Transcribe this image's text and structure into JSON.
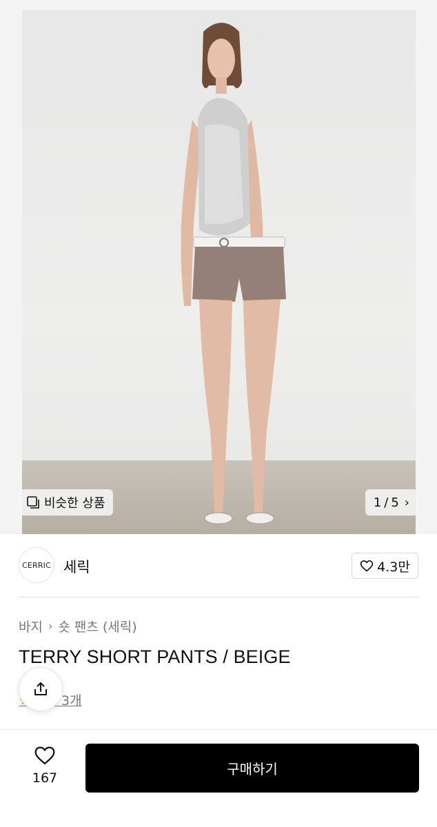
{
  "hero": {
    "similar_label": "비슷한 상품",
    "pager": {
      "current": "1",
      "separator": "/",
      "total": "5"
    }
  },
  "brand": {
    "logo_text": "CERRIC",
    "name": "세릭",
    "likes": "4.3만"
  },
  "breadcrumb": {
    "category": "바지",
    "subcategory": "숏 팬츠 (세릭)"
  },
  "product": {
    "title": "TERRY SHORT PANTS / BEIGE",
    "review_text": "후기 3개"
  },
  "bottom_bar": {
    "wish_count": "167",
    "buy_label": "구매하기"
  },
  "icons": {
    "similar": "similar-items-icon",
    "chevron": "chevron-right-icon",
    "heart": "heart-icon",
    "share": "share-icon",
    "star": "star-icon"
  },
  "colors": {
    "buy_button": "#000000",
    "muted_text": "#777777",
    "star": "#f5a623"
  }
}
